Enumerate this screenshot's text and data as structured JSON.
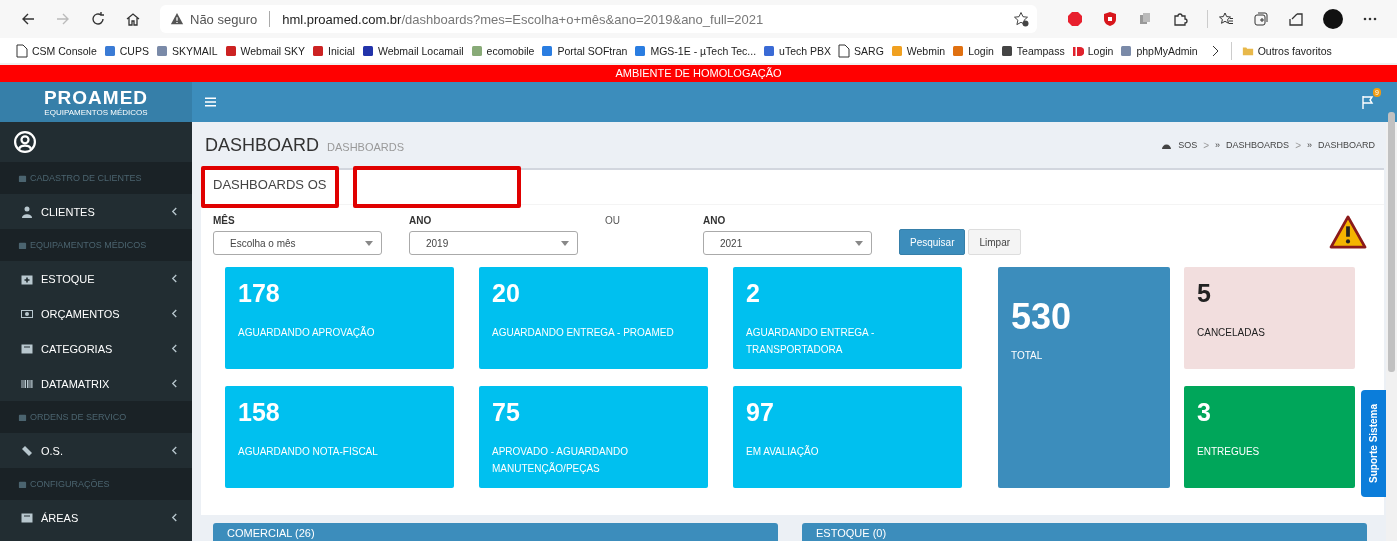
{
  "browser": {
    "security": "Não seguro",
    "url": "**hml.proamed.com.br**/dashboards?mes=Escolha+o+mês&ano=2019&ano_full=2021",
    "bookmarks": [
      {
        "label": "CSM Console",
        "kind": "page"
      },
      {
        "label": "CUPS",
        "kind": "site"
      },
      {
        "label": "SKYMAIL",
        "kind": "site"
      },
      {
        "label": "Webmail SKY",
        "kind": "site"
      },
      {
        "label": "Inicial",
        "kind": "site"
      },
      {
        "label": "Webmail Locamail",
        "kind": "site"
      },
      {
        "label": "ecomobile",
        "kind": "site"
      },
      {
        "label": "Portal SOFtran",
        "kind": "site"
      },
      {
        "label": "MGS-1E - µTech Tec...",
        "kind": "site"
      },
      {
        "label": "uTech PBX",
        "kind": "site"
      },
      {
        "label": "SARG",
        "kind": "page"
      },
      {
        "label": "Webmin",
        "kind": "site"
      },
      {
        "label": "Login",
        "kind": "site"
      },
      {
        "label": "Teampass",
        "kind": "site"
      },
      {
        "label": "Login",
        "kind": "id"
      },
      {
        "label": "phpMyAdmin",
        "kind": "site"
      }
    ],
    "other_bookmarks": "Outros favoritos"
  },
  "env_banner": "AMBIENTE DE HOMOLOGAÇÃO",
  "header": {
    "logo": "PROAMED",
    "logo_sub": "EQUIPAMENTOS MÉDICOS",
    "notification_count": "9"
  },
  "sidebar": [
    {
      "kind": "section",
      "label": "CADASTRO DE CLIENTES"
    },
    {
      "kind": "item",
      "label": "CLIENTES"
    },
    {
      "kind": "section",
      "label": "EQUIPAMENTOS MÉDICOS"
    },
    {
      "kind": "item",
      "label": "ESTOQUE"
    },
    {
      "kind": "item",
      "label": "ORÇAMENTOS"
    },
    {
      "kind": "item",
      "label": "CATEGORIAS"
    },
    {
      "kind": "item",
      "label": "DATAMATRIX"
    },
    {
      "kind": "section",
      "label": "ORDENS DE SERVICO"
    },
    {
      "kind": "item",
      "label": "O.S."
    },
    {
      "kind": "section",
      "label": "CONFIGURAÇÕES"
    },
    {
      "kind": "item",
      "label": "ÁREAS"
    }
  ],
  "page": {
    "title": "DASHBOARD",
    "subtitle": "DASHBOARDS",
    "breadcrumb": [
      {
        "label": "SOS"
      },
      {
        "sep": ">",
        "mark": "»",
        "label": "DASHBOARDS"
      },
      {
        "sep": ">",
        "mark": "»",
        "label": "DASHBOARD"
      }
    ]
  },
  "box": {
    "title": "DASHBOARDS OS",
    "filters": [
      {
        "kind": "select",
        "label": "MÊS",
        "value": "Escolha o mês"
      },
      {
        "kind": "select",
        "label": "ANO",
        "value": "2019"
      },
      {
        "kind": "separator",
        "label": "OU"
      },
      {
        "kind": "select",
        "label": "ANO",
        "value": "2021"
      }
    ],
    "buttons": [
      {
        "label": "Pesquisar",
        "kind": "primary"
      },
      {
        "label": "Limpar",
        "kind": "default"
      }
    ],
    "tiles": [
      {
        "value": "178",
        "label": "AGUARDANDO APROVAÇÃO",
        "kind": "small",
        "color": "#00c0ef"
      },
      {
        "value": "20",
        "label": "AGUARDANDO ENTREGA - PROAMED",
        "kind": "small",
        "color": "#00c0ef"
      },
      {
        "value": "2",
        "label": "AGUARDANDO ENTREGA - TRANSPORTADORA",
        "kind": "small",
        "color": "#00c0ef"
      },
      {
        "value": "530",
        "label": "TOTAL",
        "kind": "tall",
        "color": "#3c8dbc"
      },
      {
        "value": "5",
        "label": "CANCELADAS",
        "kind": "pale",
        "color": "#f2dede"
      },
      {
        "value": "158",
        "label": "AGUARDANDO NOTA-FISCAL",
        "kind": "small",
        "color": "#00c0ef"
      },
      {
        "value": "75",
        "label": "APROVADO - AGUARDANDO MANUTENÇÃO/PEÇAS",
        "kind": "small",
        "color": "#00c0ef"
      },
      {
        "value": "97",
        "label": "EM AVALIAÇÃO",
        "kind": "small",
        "color": "#00c0ef"
      },
      {
        "value": "3",
        "label": "ENTREGUES",
        "kind": "small",
        "color": "#00a65a"
      }
    ]
  },
  "panels": [
    {
      "title": "COMERCIAL (26)"
    },
    {
      "title": "ESTOQUE (0)"
    }
  ],
  "support_tab": "Suporte Sistema"
}
